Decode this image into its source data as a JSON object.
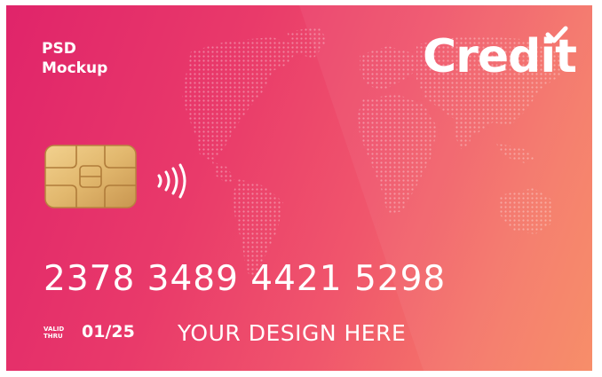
{
  "card": {
    "brand_line1": "PSD",
    "brand_line2": "Mockup",
    "logo_text": "Credit",
    "number": "2378 3489 4421 5298",
    "valid_label_line1": "VALID",
    "valid_label_line2": "THRU",
    "expiry": "01/25",
    "holder_name": "YOUR DESIGN HERE"
  },
  "icons": {
    "chip": "emv-chip-icon",
    "contactless": "contactless-icon",
    "world_map": "world-map-icon",
    "logo_check": "checkmark-icon"
  },
  "colors": {
    "gradient_start": "#e0246a",
    "gradient_end": "#f78862",
    "chip_gold": "#e2b86e",
    "text": "#ffffff"
  }
}
